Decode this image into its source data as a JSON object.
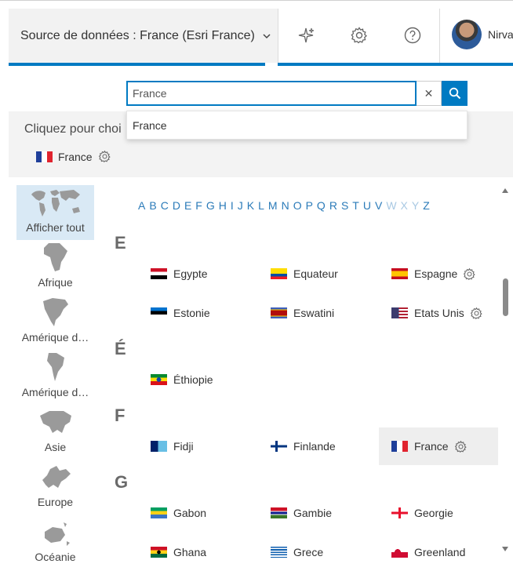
{
  "header": {
    "source_label": "Source de données : France (Esri France)",
    "username": "Nirva",
    "icons": [
      "sparkle-icon",
      "gear-icon",
      "help-icon"
    ]
  },
  "search": {
    "value": "France",
    "placeholder": "",
    "suggestion": "France"
  },
  "selection": {
    "hint": "Cliquez pour choi",
    "selected_country": "France"
  },
  "regions": [
    {
      "label": "Afficher tout",
      "icon": "world-map-icon",
      "active": true
    },
    {
      "label": "Afrique",
      "icon": "africa-map-icon"
    },
    {
      "label": "Amérique d…",
      "icon": "north-america-map-icon"
    },
    {
      "label": "Amérique d…",
      "icon": "south-america-map-icon"
    },
    {
      "label": "Asie",
      "icon": "asia-map-icon"
    },
    {
      "label": "Europe",
      "icon": "europe-map-icon"
    },
    {
      "label": "Océanie",
      "icon": "oceania-map-icon"
    }
  ],
  "alphabet": [
    "A",
    "B",
    "C",
    "D",
    "E",
    "F",
    "G",
    "H",
    "I",
    "J",
    "K",
    "L",
    "M",
    "N",
    "O",
    "P",
    "Q",
    "R",
    "S",
    "T",
    "U",
    "V",
    "W",
    "X",
    "Y",
    "Z"
  ],
  "alphabet_disabled": [
    "W",
    "X",
    "Y"
  ],
  "groups": [
    {
      "letter": "E",
      "countries": [
        {
          "name": "Egypte",
          "gear": false
        },
        {
          "name": "Equateur",
          "gear": false
        },
        {
          "name": "Espagne",
          "gear": true
        },
        {
          "name": "Estonie",
          "gear": false
        },
        {
          "name": "Eswatini",
          "gear": false
        },
        {
          "name": "Etats Unis",
          "gear": true
        }
      ]
    },
    {
      "letter": "É",
      "countries": [
        {
          "name": "Éthiopie",
          "gear": false
        }
      ]
    },
    {
      "letter": "F",
      "countries": [
        {
          "name": "Fidji",
          "gear": false
        },
        {
          "name": "Finlande",
          "gear": false
        },
        {
          "name": "France",
          "gear": true,
          "selected": true
        }
      ]
    },
    {
      "letter": "G",
      "countries": [
        {
          "name": "Gabon",
          "gear": false
        },
        {
          "name": "Gambie",
          "gear": false
        },
        {
          "name": "Georgie",
          "gear": false
        },
        {
          "name": "Ghana",
          "gear": false
        },
        {
          "name": "Grece",
          "gear": false
        },
        {
          "name": "Greenland",
          "gear": false
        }
      ]
    }
  ],
  "colors": {
    "accent": "#007ac2",
    "link": "#2b7bb9",
    "selected_bg": "#eeeeee",
    "region_active_bg": "#d9e9f5"
  }
}
